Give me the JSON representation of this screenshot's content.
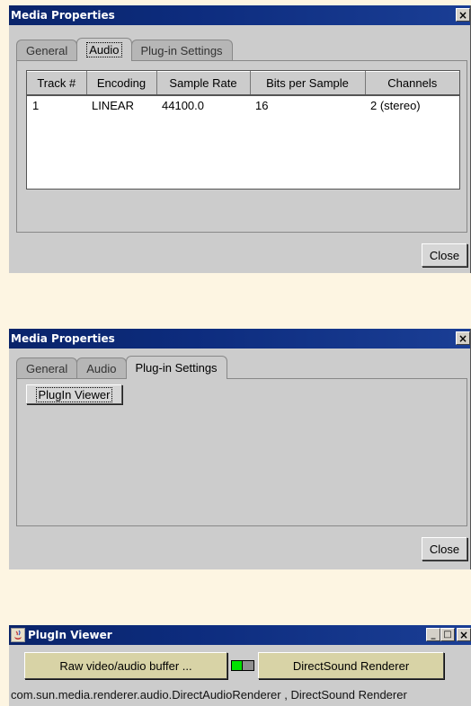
{
  "window1": {
    "title": "Media Properties",
    "close_glyph": "×",
    "tabs": [
      {
        "label": "General"
      },
      {
        "label": "Audio"
      },
      {
        "label": "Plug-in Settings"
      }
    ],
    "table": {
      "headers": [
        "Track #",
        "Encoding",
        "Sample Rate",
        "Bits per Sample",
        "Channels"
      ],
      "rows": [
        [
          "1",
          "LINEAR",
          "44100.0",
          "16",
          "2 (stereo)"
        ]
      ]
    },
    "close_label": "Close"
  },
  "window2": {
    "title": "Media Properties",
    "close_glyph": "×",
    "tabs": [
      {
        "label": "General"
      },
      {
        "label": "Audio"
      },
      {
        "label": "Plug-in Settings"
      }
    ],
    "plugin_viewer_label": "PlugIn Viewer",
    "close_label": "Close"
  },
  "window3": {
    "title": "PlugIn Viewer",
    "minimize_glyph": "_",
    "maximize_glyph": "□",
    "close_glyph": "×",
    "source_label": "Raw video/audio buffer ...",
    "renderer_label": "DirectSound Renderer",
    "status_text": "com.sun.media.renderer.audio.DirectAudioRenderer , DirectSound Renderer",
    "connector_colors": {
      "left": "#00e000",
      "right": "#909090"
    }
  }
}
